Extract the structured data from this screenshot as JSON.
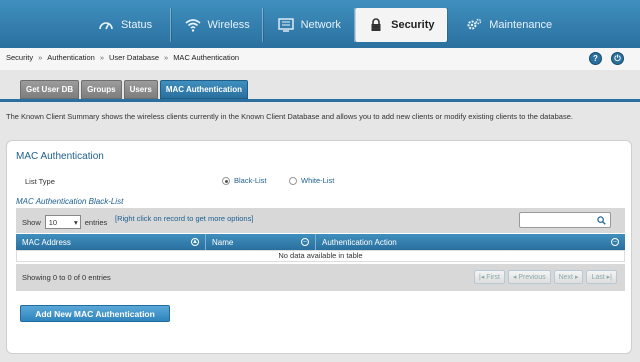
{
  "nav": {
    "items": [
      {
        "label": "Status"
      },
      {
        "label": "Wireless"
      },
      {
        "label": "Network"
      },
      {
        "label": "Security"
      },
      {
        "label": "Maintenance"
      }
    ],
    "active": "Security"
  },
  "breadcrumb": [
    "Security",
    "Authentication",
    "User Database",
    "MAC Authentication"
  ],
  "breadcrumb_sep": "»",
  "help": {
    "help_glyph": "?",
    "logout_glyph": "⏻"
  },
  "tabs": [
    {
      "label": "Get User DB"
    },
    {
      "label": "Groups"
    },
    {
      "label": "Users"
    },
    {
      "label": "MAC Authentication"
    }
  ],
  "description": "The Known Client Summary shows the wireless clients currently in the Known Client Database and allows you to add new clients or modify existing clients to the database.",
  "panel": {
    "title": "MAC Authentication",
    "list_type_label": "List Type",
    "radio_black": "Black-List",
    "radio_white": "White-List",
    "selected": "Black-List",
    "subtitle": "MAC Authentication Black-List"
  },
  "table": {
    "show_label": "Show",
    "page_size": "10",
    "entries_label": "entries",
    "hint": "[Right click on record to get more options]",
    "search_placeholder": "",
    "columns": [
      {
        "label": "MAC Address"
      },
      {
        "label": "Name"
      },
      {
        "label": "Authentication Action"
      }
    ],
    "empty_text": "No data available in table",
    "info_text": "Showing 0 to 0 of 0 entries",
    "pager": {
      "first": "First",
      "previous": "Previous",
      "next": "Next",
      "last": "Last"
    }
  },
  "add_button": "Add New MAC Authentication",
  "colors": {
    "accent": "#2a6f9e",
    "link": "#1d5f8f"
  }
}
